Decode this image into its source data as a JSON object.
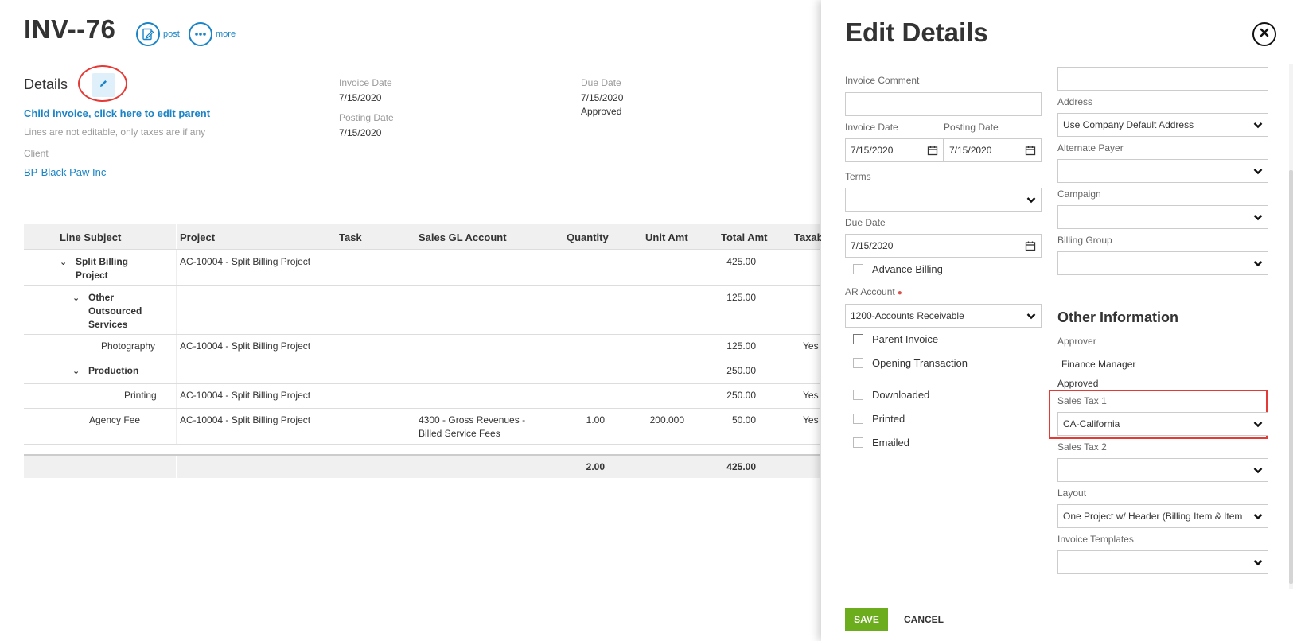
{
  "invoice": {
    "title": "INV--76",
    "post_label": "post",
    "more_label": "more",
    "details_label": "Details",
    "child_link": "Child invoice, click here to edit parent",
    "lines_note": "Lines are not editable, only taxes are if any",
    "client_label": "Client",
    "client_value": "BP-Black Paw Inc",
    "invoice_date_label": "Invoice Date",
    "invoice_date_value": "7/15/2020",
    "posting_date_label": "Posting Date",
    "posting_date_value": "7/15/2020",
    "due_date_label": "Due Date",
    "due_date_value": "7/15/2020",
    "status_value": "Approved"
  },
  "table": {
    "headers": [
      "Line Subject",
      "Project",
      "Task",
      "Sales GL Account",
      "Quantity",
      "Unit Amt",
      "Total Amt",
      "Taxab"
    ],
    "rows": [
      {
        "subject": "Split Billing Project",
        "project": "AC-10004 - Split Billing Project",
        "gl": "",
        "qty": "",
        "unit": "",
        "total": "425.00",
        "tax": ""
      },
      {
        "subject": "Other Outsourced Services",
        "project": "",
        "gl": "",
        "qty": "",
        "unit": "",
        "total": "125.00",
        "tax": ""
      },
      {
        "subject": "Photography",
        "project": "AC-10004 - Split Billing Project",
        "gl": "",
        "qty": "",
        "unit": "",
        "total": "125.00",
        "tax": "Yes"
      },
      {
        "subject": "Production",
        "project": "",
        "gl": "",
        "qty": "",
        "unit": "",
        "total": "250.00",
        "tax": ""
      },
      {
        "subject": "Printing",
        "project": "AC-10004 - Split Billing Project",
        "gl": "",
        "qty": "",
        "unit": "",
        "total": "250.00",
        "tax": "Yes"
      },
      {
        "subject": "Agency Fee",
        "project": "AC-10004 - Split Billing Project",
        "gl": "4300 - Gross Revenues - Billed Service Fees",
        "qty": "1.00",
        "unit": "200.000",
        "total": "50.00",
        "tax": "Yes"
      }
    ],
    "footer": {
      "qty": "2.00",
      "total": "425.00"
    }
  },
  "panel": {
    "title": "Edit Details",
    "invoice_comment_label": "Invoice Comment",
    "invoice_comment_value": "",
    "invoice_date_label": "Invoice Date",
    "invoice_date_value": "7/15/2020",
    "posting_date_label": "Posting Date",
    "posting_date_value": "7/15/2020",
    "terms_label": "Terms",
    "terms_value": "",
    "due_date_label": "Due Date",
    "due_date_value": "7/15/2020",
    "advance_billing_label": "Advance Billing",
    "ar_account_label": "AR Account",
    "ar_account_value": "1200-Accounts Receivable",
    "parent_invoice_label": "Parent Invoice",
    "opening_transaction_label": "Opening Transaction",
    "downloaded_label": "Downloaded",
    "printed_label": "Printed",
    "emailed_label": "Emailed",
    "address_label": "Address",
    "address_value": "Use Company Default Address",
    "alternate_payer_label": "Alternate Payer",
    "alternate_payer_value": "",
    "campaign_label": "Campaign",
    "campaign_value": "",
    "billing_group_label": "Billing Group",
    "billing_group_value": "",
    "other_info_title": "Other Information",
    "approver_label": "Approver",
    "approver_value": "Finance Manager",
    "approval_status": "Approved",
    "sales_tax1_label": "Sales Tax 1",
    "sales_tax1_value": "CA-California",
    "sales_tax2_label": "Sales Tax 2",
    "sales_tax2_value": "",
    "layout_label": "Layout",
    "layout_value": "One Project w/ Header (Billing Item & Item",
    "invoice_templates_label": "Invoice Templates",
    "invoice_templates_value": "",
    "save_label": "SAVE",
    "cancel_label": "CANCEL"
  },
  "colors": {
    "link": "#1a84c6",
    "save": "#6cad1d",
    "highlight": "#e53935"
  },
  "icons": [
    "edit-document-icon",
    "more-dots-icon",
    "pencil-icon",
    "close-icon",
    "calendar-icon",
    "chevron-down-icon"
  ]
}
